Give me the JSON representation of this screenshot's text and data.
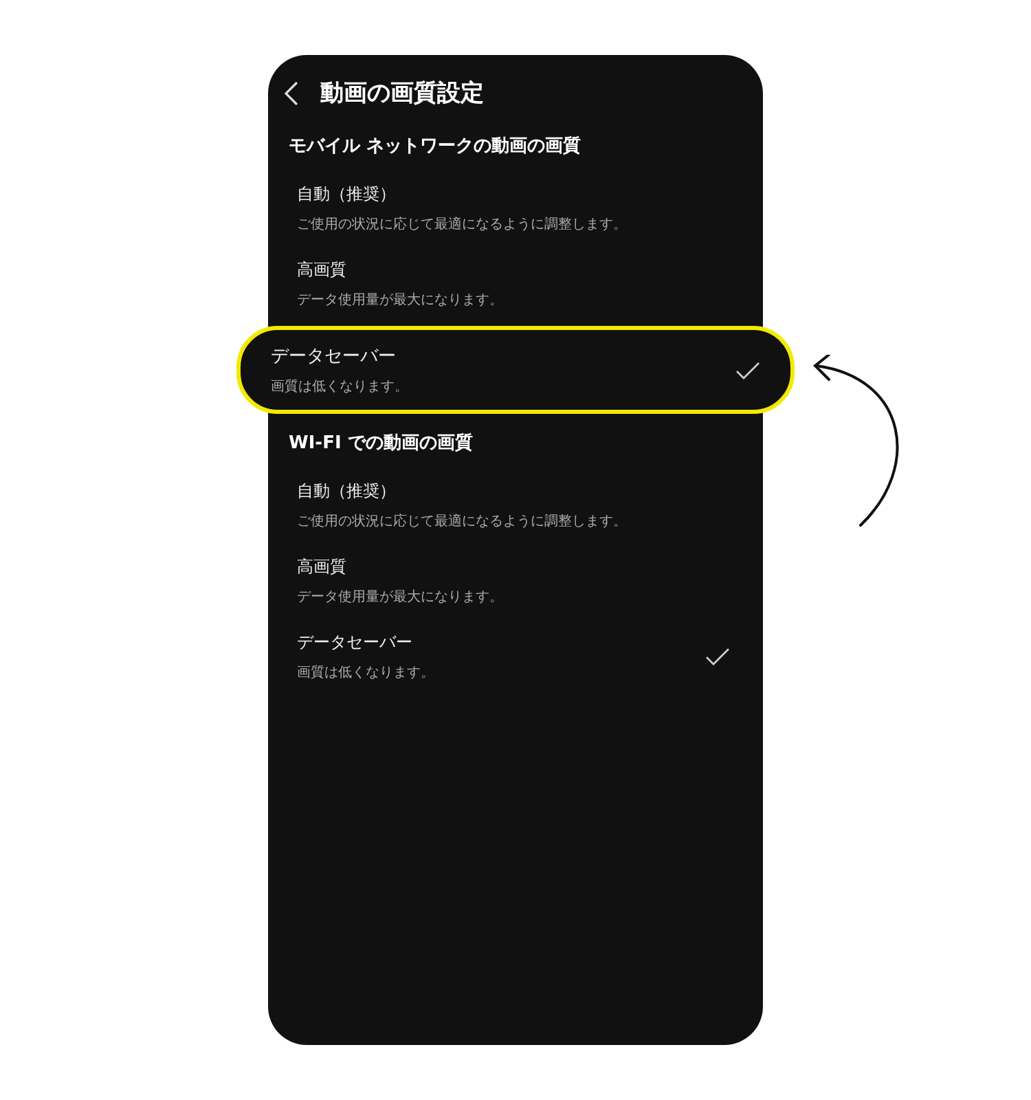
{
  "header": {
    "title": "動画の画質設定"
  },
  "sections": [
    {
      "heading": "モバイル ネットワークの動画の画質",
      "options": [
        {
          "label": "自動（推奨）",
          "description": "ご使用の状況に応じて最適になるように調整します。",
          "selected": false,
          "highlighted": false
        },
        {
          "label": "高画質",
          "description": "データ使用量が最大になります。",
          "selected": false,
          "highlighted": false
        },
        {
          "label": "データセーバー",
          "description": "画質は低くなります。",
          "selected": true,
          "highlighted": true
        }
      ]
    },
    {
      "heading": "WI-FI での動画の画質",
      "options": [
        {
          "label": "自動（推奨）",
          "description": "ご使用の状況に応じて最適になるように調整します。",
          "selected": false,
          "highlighted": false
        },
        {
          "label": "高画質",
          "description": "データ使用量が最大になります。",
          "selected": false,
          "highlighted": false
        },
        {
          "label": "データセーバー",
          "description": "画質は低くなります。",
          "selected": true,
          "highlighted": false
        }
      ]
    }
  ]
}
